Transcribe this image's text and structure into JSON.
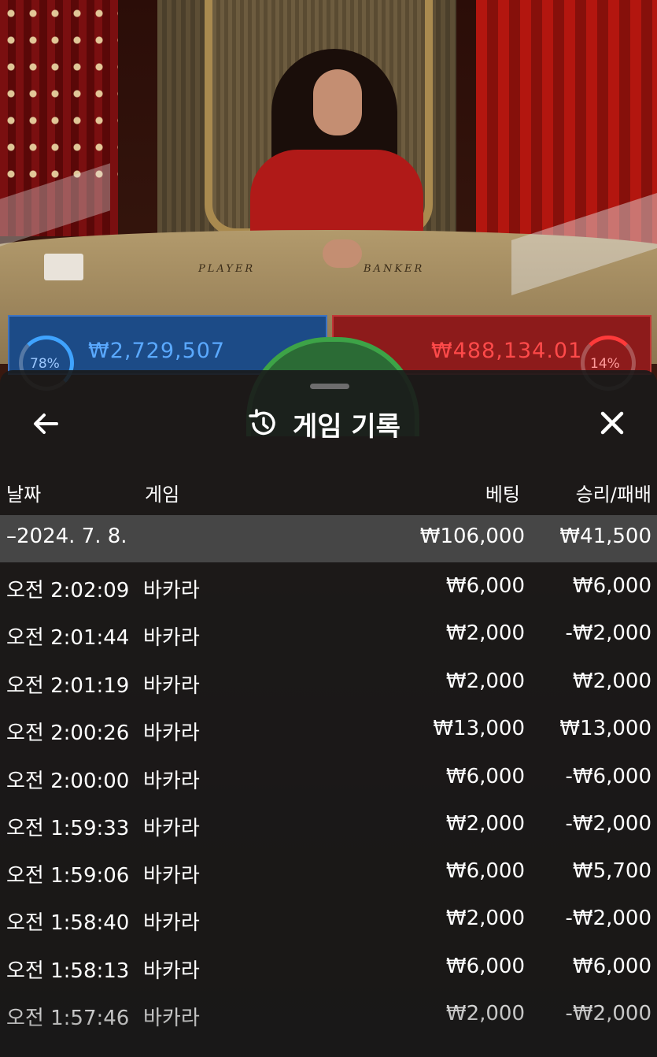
{
  "background": {
    "table_left_label": "PLAYER",
    "table_right_label": "BANKER",
    "player_percent": "78%",
    "player_amount": "₩2,729,507",
    "banker_percent": "14%",
    "banker_amount": "₩488,134.01",
    "colors": {
      "player": "#1c4b87",
      "banker": "#8d1b1b",
      "tie": "#2b6b35"
    }
  },
  "header": {
    "back_icon": "arrow-left-icon",
    "history_icon": "history-clock-icon",
    "title": "게임 기록",
    "close_icon": "close-icon"
  },
  "columns": {
    "date": "날짜",
    "game": "게임",
    "bet": "베팅",
    "result": "승리/패배"
  },
  "date_group": {
    "label": "–2024. 7. 8.",
    "total_bet": "₩106,000",
    "total_result": "₩41,500"
  },
  "rows": [
    {
      "time": "오전 2:02:09",
      "game": "바카라",
      "bet": "₩6,000",
      "result": "₩6,000"
    },
    {
      "time": "오전 2:01:44",
      "game": "바카라",
      "bet": "₩2,000",
      "result": "-₩2,000"
    },
    {
      "time": "오전 2:01:19",
      "game": "바카라",
      "bet": "₩2,000",
      "result": "₩2,000"
    },
    {
      "time": "오전 2:00:26",
      "game": "바카라",
      "bet": "₩13,000",
      "result": "₩13,000"
    },
    {
      "time": "오전 2:00:00",
      "game": "바카라",
      "bet": "₩6,000",
      "result": "-₩6,000"
    },
    {
      "time": "오전 1:59:33",
      "game": "바카라",
      "bet": "₩2,000",
      "result": "-₩2,000"
    },
    {
      "time": "오전 1:59:06",
      "game": "바카라",
      "bet": "₩6,000",
      "result": "₩5,700"
    },
    {
      "time": "오전 1:58:40",
      "game": "바카라",
      "bet": "₩2,000",
      "result": "-₩2,000"
    },
    {
      "time": "오전 1:58:13",
      "game": "바카라",
      "bet": "₩6,000",
      "result": "₩6,000"
    },
    {
      "time": "오전 1:57:46",
      "game": "바카라",
      "bet": "₩2,000",
      "result": "-₩2,000"
    }
  ]
}
